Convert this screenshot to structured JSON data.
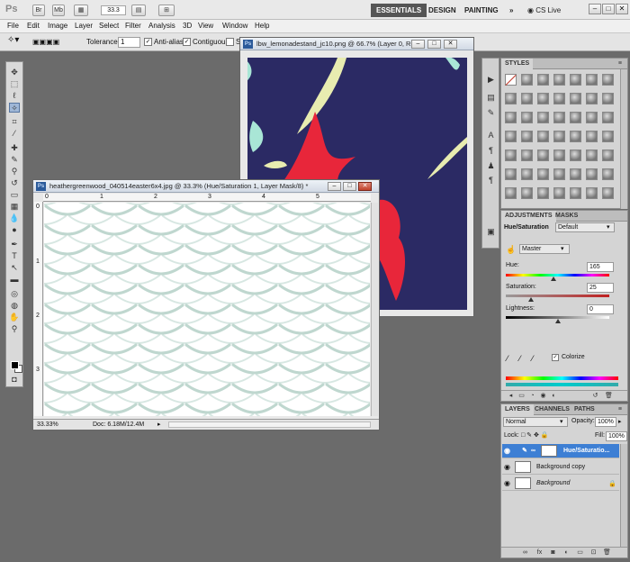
{
  "app": {
    "logo": "Ps",
    "zoom": "33.3",
    "workspaces": [
      "ESSENTIALS",
      "DESIGN",
      "PAINTING"
    ],
    "more": "»",
    "cs_live": "CS Live"
  },
  "menu": [
    "File",
    "Edit",
    "Image",
    "Layer",
    "Select",
    "Filter",
    "Analysis",
    "3D",
    "View",
    "Window",
    "Help"
  ],
  "options": {
    "tolerance_label": "Tolerance:",
    "tolerance_value": "1",
    "antialias_label": "Anti-alias",
    "contiguous_label": "Contiguous",
    "sample_label": "S"
  },
  "doc_back": {
    "title": "lbw_lemonadestand_jc10.png @ 66.7% (Layer 0, RG..."
  },
  "doc_front": {
    "title": "heathergreenwood_040514easter6x4.jpg @ 33.3% (Hue/Saturation 1, Layer Mask/8) *",
    "zoom": "33.33%",
    "doc_size": "Doc: 6.18M/12.4M",
    "ruler_h": [
      "0",
      "1",
      "2",
      "3",
      "4",
      "5"
    ],
    "ruler_v": [
      "0",
      "1",
      "2",
      "3"
    ]
  },
  "styles_panel": {
    "tab": "STYLES"
  },
  "adjustments": {
    "tabs": [
      "ADJUSTMENTS",
      "MASKS"
    ],
    "type": "Hue/Saturation",
    "preset": "Default",
    "channel": "Master",
    "hue_label": "Hue:",
    "hue_value": "165",
    "sat_label": "Saturation:",
    "sat_value": "25",
    "light_label": "Lightness:",
    "light_value": "0",
    "colorize_label": "Colorize"
  },
  "layers": {
    "tabs": [
      "LAYERS",
      "CHANNELS",
      "PATHS"
    ],
    "blend_mode": "Normal",
    "opacity_label": "Opacity:",
    "opacity_value": "100%",
    "lock_label": "Lock:",
    "fill_label": "Fill:",
    "fill_value": "100%",
    "rows": [
      "Hue/Saturatio...",
      "Background copy",
      "Background"
    ]
  }
}
